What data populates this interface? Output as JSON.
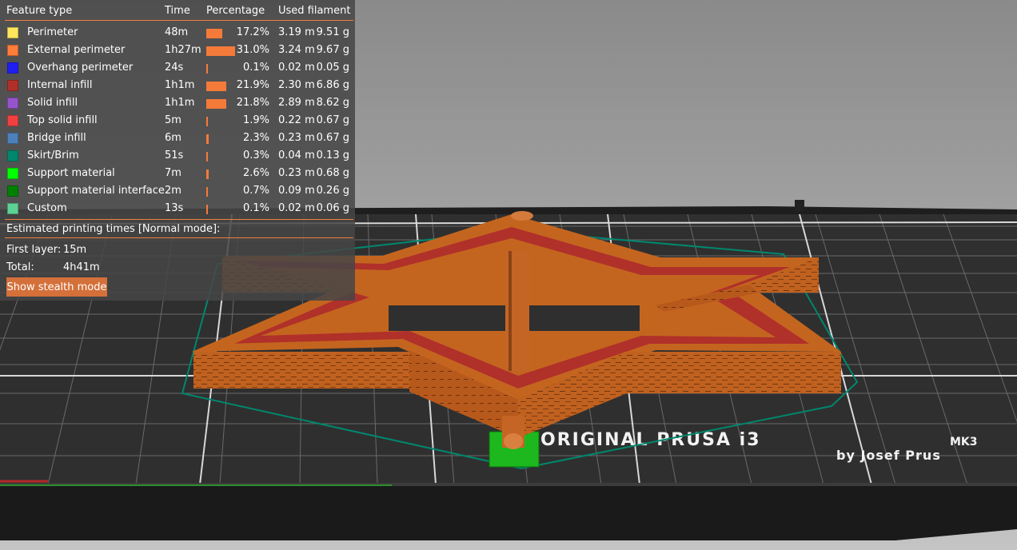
{
  "legend": {
    "header": {
      "feature_type": "Feature type",
      "time": "Time",
      "percentage": "Percentage",
      "used_filament": "Used filament"
    },
    "rows": [
      {
        "name": "Perimeter",
        "color": "#ffe65c",
        "time": "48m",
        "percent": "17.2%",
        "pct_value": 0.172,
        "length": "3.19 m",
        "mass": "9.51 g"
      },
      {
        "name": "External perimeter",
        "color": "#ff7d38",
        "time": "1h27m",
        "percent": "31.0%",
        "pct_value": 0.31,
        "length": "3.24 m",
        "mass": "9.67 g"
      },
      {
        "name": "Overhang perimeter",
        "color": "#1f1ff2",
        "time": "24s",
        "percent": "0.1%",
        "pct_value": 0.001,
        "length": "0.02 m",
        "mass": "0.05 g"
      },
      {
        "name": "Internal infill",
        "color": "#b03029",
        "time": "1h1m",
        "percent": "21.9%",
        "pct_value": 0.219,
        "length": "2.30 m",
        "mass": "6.86 g"
      },
      {
        "name": "Solid infill",
        "color": "#9654cc",
        "time": "1h1m",
        "percent": "21.8%",
        "pct_value": 0.218,
        "length": "2.89 m",
        "mass": "8.62 g"
      },
      {
        "name": "Top solid infill",
        "color": "#f04040",
        "time": "5m",
        "percent": "1.9%",
        "pct_value": 0.019,
        "length": "0.22 m",
        "mass": "0.67 g"
      },
      {
        "name": "Bridge infill",
        "color": "#4d80ba",
        "time": "6m",
        "percent": "2.3%",
        "pct_value": 0.023,
        "length": "0.23 m",
        "mass": "0.67 g"
      },
      {
        "name": "Skirt/Brim",
        "color": "#00876e",
        "time": "51s",
        "percent": "0.3%",
        "pct_value": 0.003,
        "length": "0.04 m",
        "mass": "0.13 g"
      },
      {
        "name": "Support material",
        "color": "#00ff00",
        "time": "7m",
        "percent": "2.6%",
        "pct_value": 0.026,
        "length": "0.23 m",
        "mass": "0.68 g"
      },
      {
        "name": "Support material interface",
        "color": "#008000",
        "time": "2m",
        "percent": "0.7%",
        "pct_value": 0.007,
        "length": "0.09 m",
        "mass": "0.26 g"
      },
      {
        "name": "Custom",
        "color": "#5ed194",
        "time": "13s",
        "percent": "0.1%",
        "pct_value": 0.001,
        "length": "0.02 m",
        "mass": "0.06 g"
      }
    ]
  },
  "times": {
    "title": "Estimated printing times [Normal mode]:",
    "first_layer_label": "First layer:",
    "first_layer_value": "15m",
    "total_label": "Total:",
    "total_value": "4h41m"
  },
  "stealth_button": "Show stealth mode",
  "bed": {
    "brand_line1": "ORIGINAL PRUSA i3",
    "brand_model": "MK3",
    "brand_line2": "by Josef Prus"
  }
}
